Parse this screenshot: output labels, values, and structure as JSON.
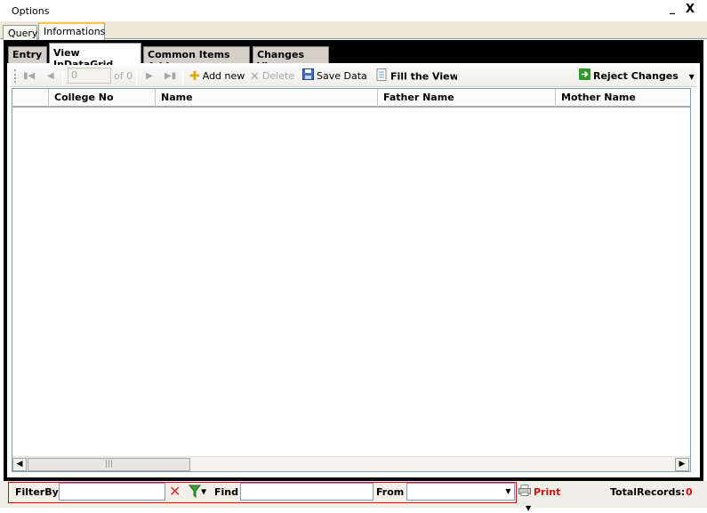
{
  "window": {
    "title": "Options",
    "minimize_label": "_",
    "close_label": "X"
  },
  "outer_tabs": {
    "query": "Query",
    "informations": "Informations"
  },
  "inner_tabs": {
    "entry": "Entry",
    "view_grid": "View InDataGrid",
    "common_items": "Common Items Add",
    "changes_view": "Changes View"
  },
  "toolbar": {
    "position_value": "0",
    "of_count": "of 0",
    "add_new": "Add new",
    "delete": "Delete",
    "save_data": "Save Data",
    "fill_view": "Fill the View",
    "reject_changes": "Reject Changes"
  },
  "grid": {
    "columns": [
      "College No",
      "Name",
      "Father Name",
      "Mother Name"
    ],
    "rows": []
  },
  "filter_bar": {
    "filter_by_label": "FilterBy",
    "filter_value": "",
    "find_label": "Find",
    "find_value": "",
    "from_label": "From",
    "from_value": "",
    "print_label": "Print",
    "total_records_label": "TotalRecords:",
    "total_records_value": "0"
  },
  "colors": {
    "accent_tab": "#ffc83c",
    "alert_red": "#d01010",
    "frame": "#000000"
  }
}
